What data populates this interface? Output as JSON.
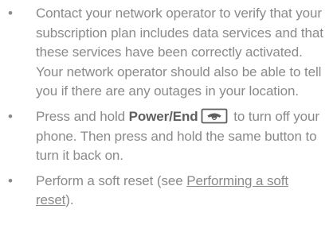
{
  "bullet_symbol": "•",
  "items": [
    {
      "text": "Contact your network operator to verify that your subscription plan includes data services and that these services have been correctly activated. Your network operator should also be able to tell you if there are any outages in your location."
    },
    {
      "before": "Press and hold ",
      "key_label": "Power/End",
      "key_icon": "power-end-phone-icon",
      "after": " to turn off your phone. Then press and hold the same button to turn it back on."
    },
    {
      "before": "Perform a soft reset (see ",
      "link_text": "Performing a soft reset",
      "after": ")."
    }
  ]
}
